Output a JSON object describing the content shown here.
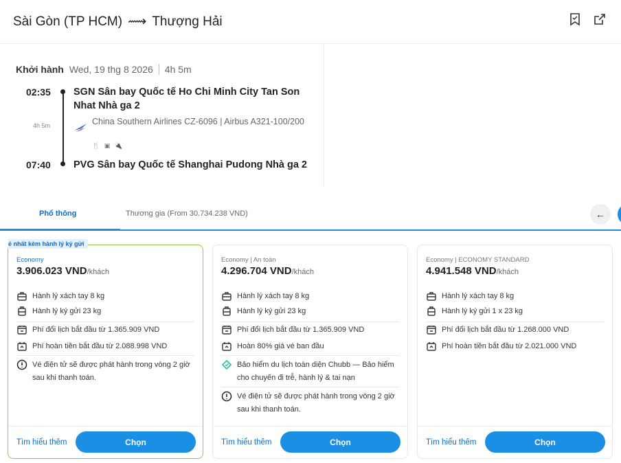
{
  "header": {
    "origin": "Sài Gòn (TP HCM)",
    "arrow": "⟿",
    "destination": "Thượng Hải",
    "icons": [
      "bookmark-icon",
      "share-icon"
    ]
  },
  "flight": {
    "departure_label": "Khởi hành",
    "date": "Wed, 19 thg 8 2026",
    "duration": "4h 5m",
    "depart_time": "02:35",
    "depart_airport": "SGN Sân bay Quốc tế Ho Chi Minh City Tan Son Nhat Nhà ga 2",
    "segment_duration": "4h 5m",
    "airline_info": "China Southern Airlines CZ-6096  |  Airbus A321-100/200",
    "amenities": "🍴 ▣ 🔌",
    "arrive_time": "07:40",
    "arrive_airport": "PVG Sân bay Quốc tế Shanghai Pudong Nhà ga 2"
  },
  "tabs": [
    {
      "label": "Phổ thông",
      "active": true
    },
    {
      "label": "Thương gia (From 30.734.238 VND)",
      "active": false
    }
  ],
  "nav": {
    "prev_icon": "arrow-left-icon",
    "prev_glyph": "←"
  },
  "cards": [
    {
      "tag": "ẻ nhất kèm hành lý ký gửi",
      "fare_class": "Economy",
      "price": "3.906.023 VND",
      "per": "/khách",
      "features": [
        {
          "icon": "cabin-bag-icon",
          "text": "Hành lý xách tay 8 kg"
        },
        {
          "icon": "checked-bag-icon",
          "text": "Hành lý ký gửi 23 kg"
        },
        {
          "icon": "calendar-change-icon",
          "text": "Phí đổi lịch bắt đầu từ 1.365.909 VND"
        },
        {
          "icon": "refund-icon",
          "text": "Phí hoàn tiền bắt đầu từ 2.088.998 VND"
        },
        {
          "icon": "info-icon",
          "text": "Vé điện tử sẽ được phát hành trong vòng 2 giờ sau khi thanh toán."
        }
      ],
      "learn_more": "Tìm hiểu thêm",
      "choose": "Chọn"
    },
    {
      "fare_class": "Economy | An toàn",
      "price": "4.296.704 VND",
      "per": "/khách",
      "features": [
        {
          "icon": "cabin-bag-icon",
          "text": "Hành lý xách tay 8 kg"
        },
        {
          "icon": "checked-bag-icon",
          "text": "Hành lý ký gửi 23 kg"
        },
        {
          "icon": "calendar-change-icon",
          "text": "Phí đổi lịch bắt đầu từ 1.365.909 VND"
        },
        {
          "icon": "refund-icon",
          "text": "Hoàn 80% giá vé ban đầu"
        },
        {
          "icon": "insurance-icon",
          "text": "Bảo hiểm du lịch toàn diện Chubb — Bảo hiểm cho chuyến đi trễ, hành lý & tai nạn"
        },
        {
          "icon": "info-icon",
          "text": "Vé điện tử sẽ được phát hành trong vòng 2 giờ sau khi thanh toán."
        }
      ],
      "learn_more": "Tìm hiểu thêm",
      "choose": "Chọn"
    },
    {
      "fare_class": "Economy | ECONOMY STANDARD",
      "price": "4.941.548 VND",
      "per": "/khách",
      "features": [
        {
          "icon": "cabin-bag-icon",
          "text": "Hành lý xách tay 8 kg"
        },
        {
          "icon": "checked-bag-icon",
          "text": "Hành lý ký gửi 1 x 23 kg"
        },
        {
          "icon": "calendar-change-icon",
          "text": "Phí đổi lịch bắt đầu từ 1.268.000 VND"
        },
        {
          "icon": "refund-icon",
          "text": "Phí hoàn tiền bắt đầu từ 2.021.000 VND"
        }
      ],
      "learn_more": "Tìm hiểu thêm",
      "choose": "Chọn"
    }
  ],
  "colors": {
    "accent": "#1a8fe3",
    "selected_border": "#8fcf3a",
    "link": "#0b6bcb"
  }
}
